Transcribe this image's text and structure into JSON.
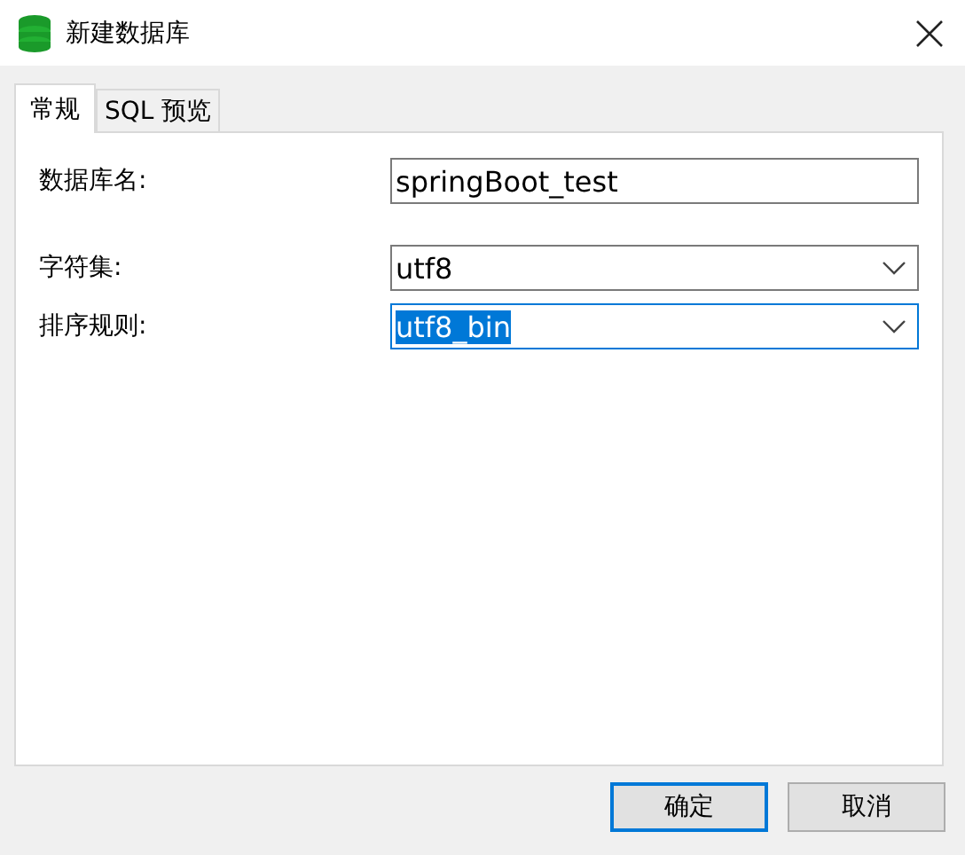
{
  "window": {
    "title": "新建数据库"
  },
  "tabs": [
    {
      "label": "常规",
      "selected": true
    },
    {
      "label": "SQL 预览",
      "selected": false
    }
  ],
  "fields": [
    {
      "kind": "text",
      "label": "数据库名:",
      "value": "springBoot_test",
      "focused": false
    },
    {
      "kind": "select",
      "label": "字符集:",
      "value": "utf8",
      "focused": false
    },
    {
      "kind": "select",
      "label": "排序规则:",
      "value": "utf8_bin",
      "focused": true
    }
  ],
  "buttons": [
    {
      "label": "确定",
      "default": true
    },
    {
      "label": "取消",
      "default": false
    }
  ]
}
